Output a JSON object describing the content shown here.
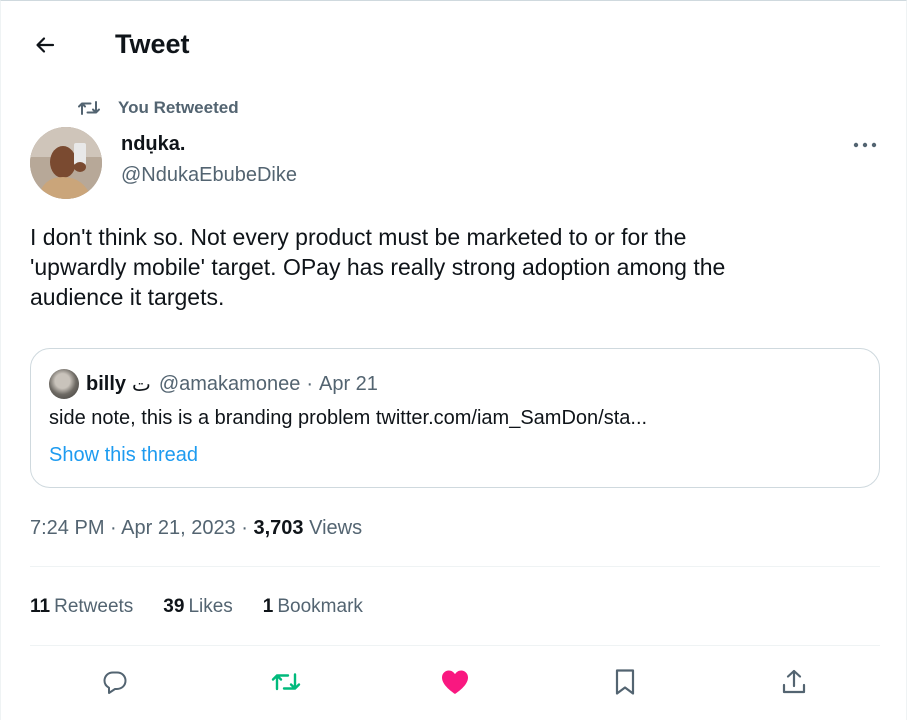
{
  "header": {
    "title": "Tweet"
  },
  "retweet_context": {
    "label": "You Retweeted"
  },
  "tweet": {
    "author_name": "ndụka.",
    "author_handle": "@NdukaEbubeDike",
    "text": "I don't think so. Not every product must be marketed to or for the\n'upwardly mobile' target. OPay has really strong adoption among the\naudience it targets.",
    "timestamp": "7:24 PM · Apr 21, 2023",
    "meta_sep": " · ",
    "views_count": "3,703",
    "views_label": "Views"
  },
  "quote": {
    "author_name": "billy",
    "name_suffix": "ت",
    "author_handle": "@amakamonee",
    "separator": "·",
    "date": "Apr 21",
    "text": "side note, this is a branding problem twitter.com/iam_SamDon/sta...",
    "show_thread": "Show this thread"
  },
  "stats": {
    "retweets_count": "11",
    "retweets_label": "Retweets",
    "likes_count": "39",
    "likes_label": "Likes",
    "bookmarks_count": "1",
    "bookmarks_label": "Bookmark"
  },
  "actions": {
    "reply_icon": "reply-icon",
    "retweet_icon": "retweet-icon",
    "like_icon": "heart-icon",
    "bookmark_icon": "bookmark-icon",
    "share_icon": "share-icon"
  },
  "colors": {
    "retweet_active": "#00ba7c",
    "like_active": "#f91880",
    "link": "#1d9bf0",
    "secondary_text": "#536471"
  }
}
